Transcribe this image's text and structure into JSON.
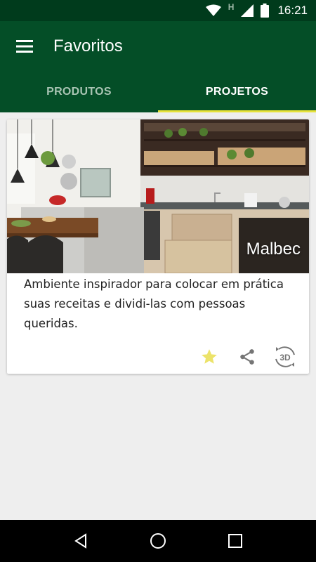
{
  "status_bar": {
    "time": "16:21",
    "network_letter": "H",
    "icons": [
      "wifi-icon",
      "network-type-icon",
      "signal-icon",
      "battery-icon"
    ]
  },
  "app_bar": {
    "menu_icon": "menu-icon",
    "title": "Favoritos"
  },
  "tabs": [
    {
      "label": "PRODUTOS",
      "active": false
    },
    {
      "label": "PROJETOS",
      "active": true
    }
  ],
  "card": {
    "image_caption": "Malbec",
    "description": "Ambiente inspirador para colocar em prática suas receitas e dividi-las com pessoas queridas.",
    "actions": {
      "favorite_icon": "star-icon",
      "share_icon": "share-icon",
      "view3d_label": "3D"
    }
  },
  "colors": {
    "status_bar": "#003b1c",
    "app_bar": "#044e27",
    "tab_indicator": "#e7e33b",
    "star": "#ece36a",
    "background": "#eeeeee"
  },
  "nav_bar": {
    "icons": [
      "back-icon",
      "home-icon",
      "recents-icon"
    ]
  }
}
